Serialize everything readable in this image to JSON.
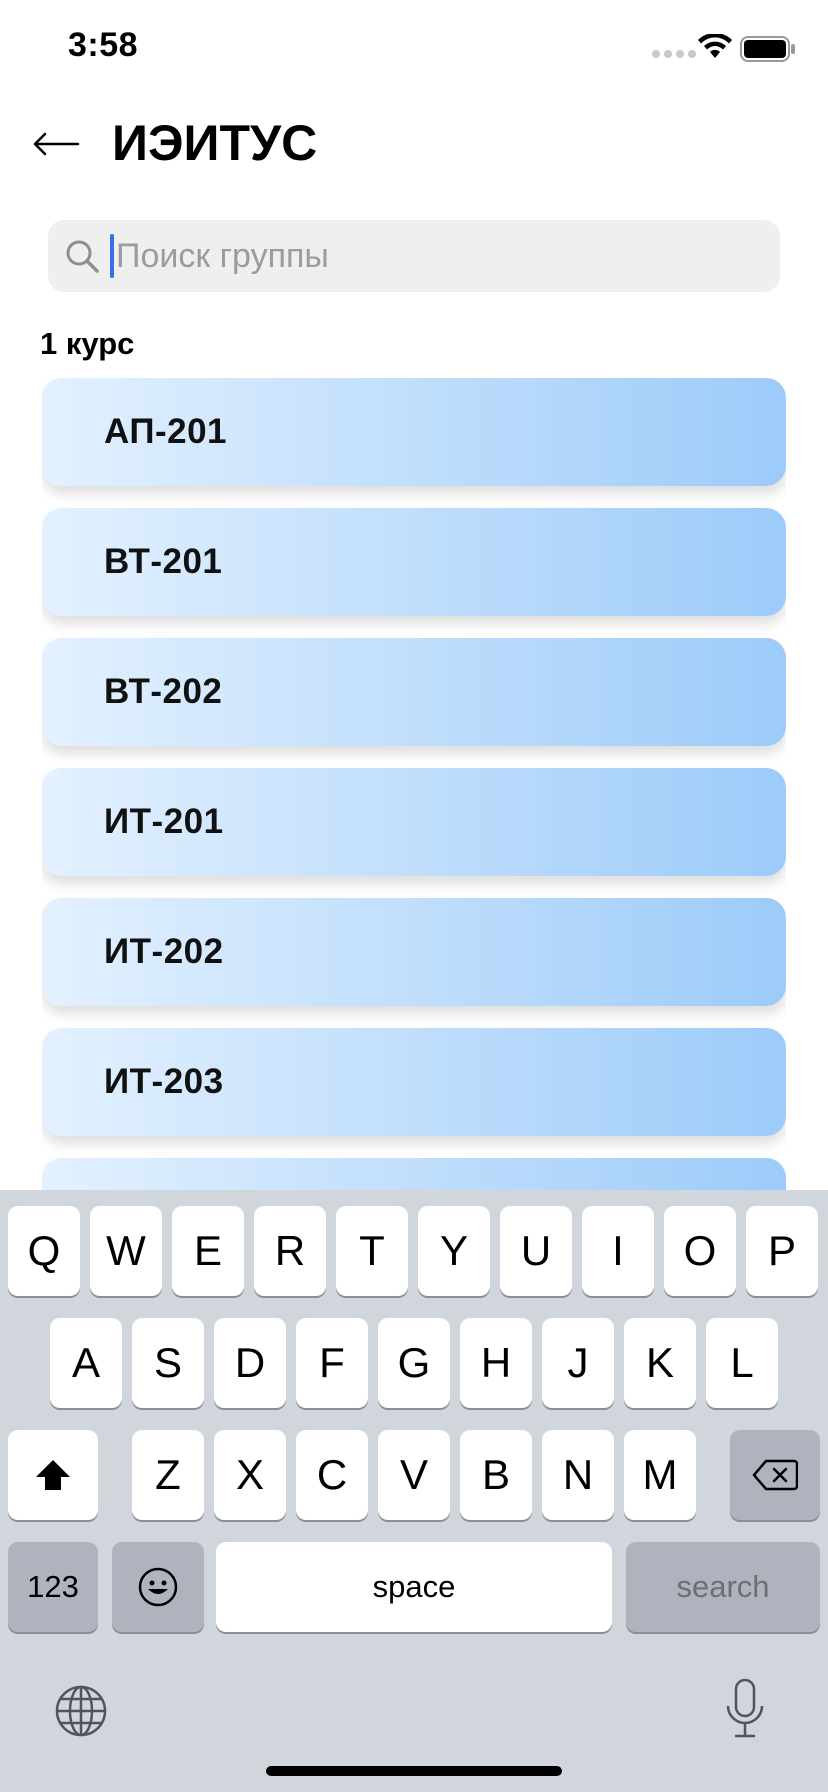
{
  "status_bar": {
    "time": "3:58"
  },
  "header": {
    "title": "ИЭИТУС"
  },
  "search": {
    "placeholder": "Поиск группы",
    "value": ""
  },
  "section": {
    "title": "1 курс"
  },
  "groups": [
    "АП-201",
    "ВТ-201",
    "ВТ-202",
    "ИТ-201",
    "ИТ-202",
    "ИТ-203"
  ],
  "keyboard": {
    "row1": [
      "Q",
      "W",
      "E",
      "R",
      "T",
      "Y",
      "U",
      "I",
      "O",
      "P"
    ],
    "row2": [
      "A",
      "S",
      "D",
      "F",
      "G",
      "H",
      "J",
      "K",
      "L"
    ],
    "row3": [
      "Z",
      "X",
      "C",
      "V",
      "B",
      "N",
      "M"
    ],
    "numbers_label": "123",
    "space_label": "space",
    "search_label": "search"
  },
  "colors": {
    "accent": "#3d6ee8",
    "card_start": "#e3f1ff",
    "card_end": "#9ccbfa",
    "keyboard_bg": "#d1d5dc"
  }
}
